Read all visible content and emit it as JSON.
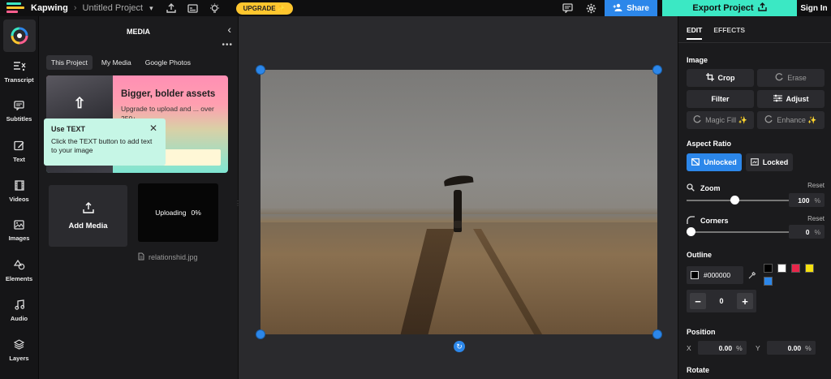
{
  "app": {
    "name": "Kapwing",
    "project_title": "Untitled Project",
    "upgrade_label": "UPGRADE ✨"
  },
  "topbar": {
    "share_label": "Share",
    "export_label": "Export Project",
    "signin_label": "Sign In"
  },
  "nav": {
    "items": [
      {
        "label": "Transcript",
        "icon": "transcript-icon"
      },
      {
        "label": "Subtitles",
        "icon": "subtitles-icon"
      },
      {
        "label": "Text",
        "icon": "text-icon"
      },
      {
        "label": "Videos",
        "icon": "videos-icon"
      },
      {
        "label": "Images",
        "icon": "images-icon"
      },
      {
        "label": "Elements",
        "icon": "elements-icon"
      },
      {
        "label": "Audio",
        "icon": "audio-icon"
      },
      {
        "label": "Layers",
        "icon": "layers-icon"
      }
    ]
  },
  "media": {
    "title": "MEDIA",
    "tabs": [
      {
        "label": "This Project",
        "active": true
      },
      {
        "label": "My Media",
        "active": false
      },
      {
        "label": "Google Photos",
        "active": false
      }
    ],
    "promo": {
      "title": "Bigger, bolder assets",
      "text": "Upgrade to upload and ... over 250+"
    },
    "tooltip": {
      "title": "Use TEXT",
      "text": "Click the TEXT button to add text to your image"
    },
    "add_media_label": "Add Media",
    "uploading_label": "Uploading",
    "uploading_progress": "0%",
    "filename": "relationshid.jpg"
  },
  "panel": {
    "tabs": [
      {
        "label": "EDIT",
        "active": true
      },
      {
        "label": "EFFECTS",
        "active": false
      }
    ],
    "image_section": "Image",
    "buttons": {
      "crop": "Crop",
      "erase": "Erase",
      "filter": "Filter",
      "adjust": "Adjust",
      "magic_fill": "Magic Fill ✨",
      "enhance": "Enhance ✨"
    },
    "aspect_section": "Aspect Ratio",
    "aspect": {
      "unlocked": "Unlocked",
      "locked": "Locked",
      "selected": "Unlocked"
    },
    "zoom": {
      "label": "Zoom",
      "reset": "Reset",
      "value": "100",
      "unit": "%",
      "level": 0.45
    },
    "corners": {
      "label": "Corners",
      "reset": "Reset",
      "value": "0",
      "unit": "%",
      "level": 0.0
    },
    "outline": {
      "label": "Outline",
      "hex": "#000000",
      "swatches": [
        "#000000",
        "#ffffff",
        "#e8264a",
        "#f5e110",
        "#2c87ea"
      ],
      "width_value": "0"
    },
    "position": {
      "label": "Position",
      "x_label": "X",
      "x_value": "0.00",
      "y_label": "Y",
      "y_value": "0.00",
      "unit": "%"
    },
    "rotate_label": "Rotate"
  },
  "colors": {
    "accent": "#2c87ea",
    "export": "#3be8c4",
    "upgrade": "#ffc62e",
    "tooltip": "#c6f6e6"
  }
}
